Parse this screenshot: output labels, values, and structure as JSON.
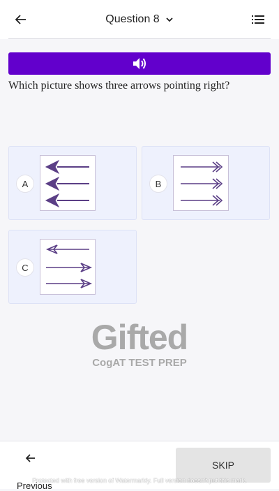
{
  "header": {
    "title": "Question 8",
    "back_icon": "arrow-left-icon",
    "dropdown_icon": "chevron-down-icon",
    "menu_icon": "list-icon"
  },
  "audio": {
    "icon": "speaker-icon",
    "color": "#6200cc"
  },
  "question": {
    "text": "Which picture shows three arrows pointing right?"
  },
  "options": [
    {
      "letter": "A",
      "arrows": [
        "left-filled",
        "left-filled",
        "left-filled"
      ]
    },
    {
      "letter": "B",
      "arrows": [
        "right-double",
        "right-double",
        "right-double"
      ]
    },
    {
      "letter": "C",
      "arrows": [
        "left-open",
        "right-open",
        "right-open"
      ]
    }
  ],
  "logo": {
    "brand": "Gifted",
    "subtitle": "CogAT TEST PREP"
  },
  "footer": {
    "previous_label": "Previous",
    "skip_label": "SKIP",
    "watermark": "Protected with free version of Watermarkly. Full version doesn't put this mark."
  },
  "colors": {
    "arrow": "#5b3f86",
    "option_bg": "#eef1fd"
  }
}
